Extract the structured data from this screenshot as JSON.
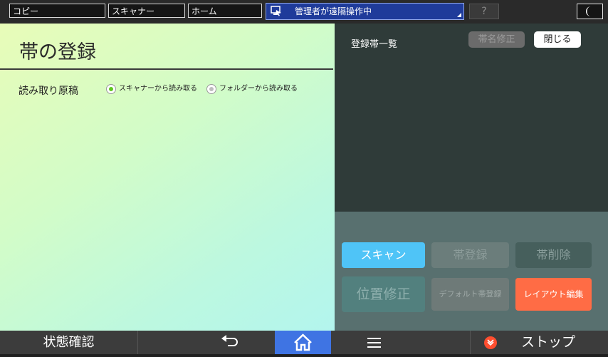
{
  "top_bar": {
    "tabs": [
      {
        "label": "コピー"
      },
      {
        "label": "スキャナー"
      },
      {
        "label": "ホーム"
      }
    ],
    "remote_status": "管理者が遠隔操作中",
    "help_label": "?"
  },
  "left_panel": {
    "title": "帯の登録",
    "source_label": "読み取り原稿",
    "options": [
      {
        "label": "スキャナーから読み取る",
        "selected": true
      },
      {
        "label": "フォルダーから読み取る",
        "selected": false
      }
    ]
  },
  "right_panel": {
    "list_title": "登録帯一覧",
    "rename_label": "帯名修正",
    "close_label": "閉じる",
    "scan_label": "スキャン",
    "register_label": "帯登録",
    "delete_label": "帯削除",
    "position_label": "位置修正",
    "default_label": "デフォルト帯登録",
    "layout_label": "レイアウト編集"
  },
  "footer": {
    "status_label": "状態確認",
    "stop_label": "ストップ"
  },
  "colors": {
    "accent_blue": "#3f74e3",
    "scan_button": "#4fc4f7",
    "layout_button": "#ff6c45",
    "stop_icon": "#ff4e2f"
  }
}
